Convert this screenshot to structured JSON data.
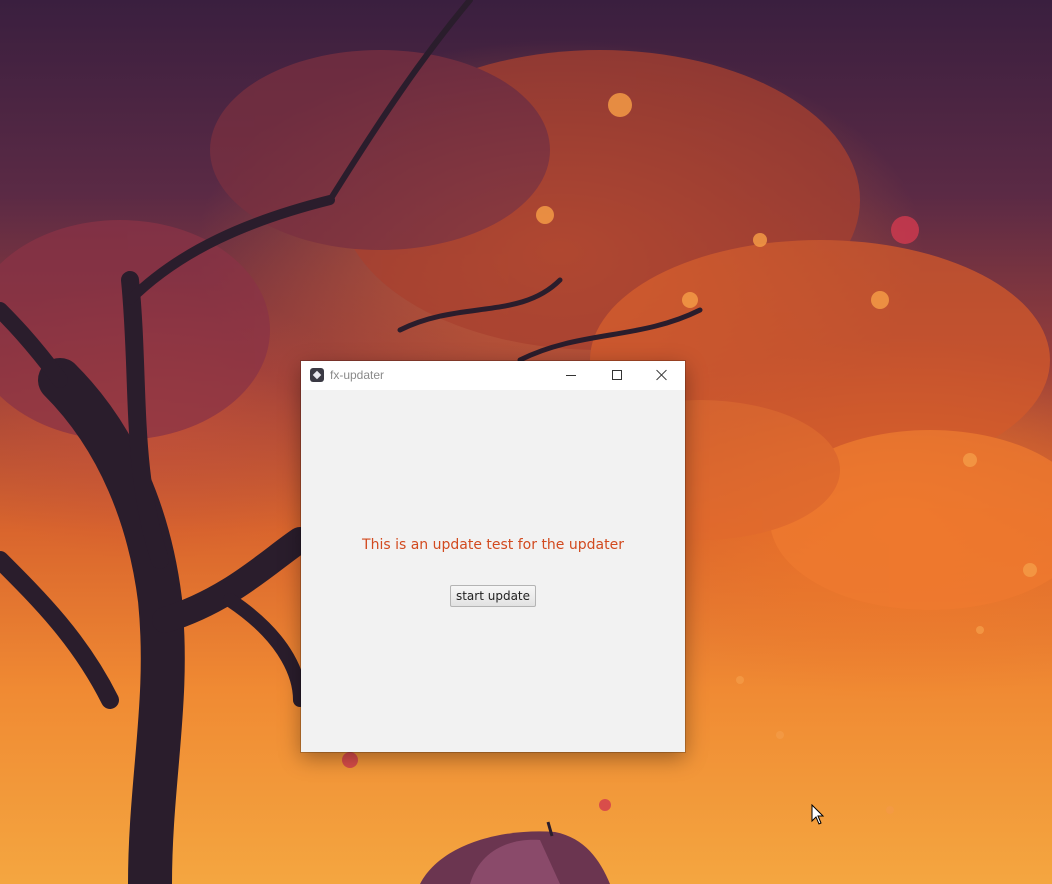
{
  "desktop": {
    "wallpaper": "autumn-tree-umbrella-painting",
    "accent_colors": [
      "#3a1f3f",
      "#9a3f3a",
      "#d9652d",
      "#f4a640"
    ]
  },
  "window": {
    "title": "fx-updater",
    "app_icon": "app-icon",
    "controls": {
      "minimize": "minimize-icon",
      "maximize": "maximize-icon",
      "close": "close-icon"
    },
    "message": "This is an update test for the updater",
    "message_color": "#d24a1f",
    "button_label": "start update"
  },
  "cursor": "arrow-cursor-icon"
}
